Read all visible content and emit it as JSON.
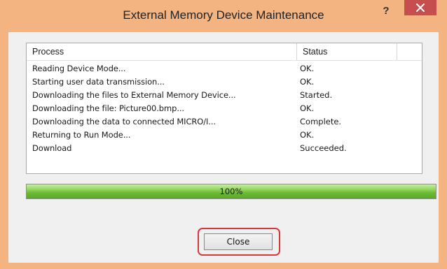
{
  "window": {
    "title": "External Memory Device Maintenance",
    "help_label": "?",
    "title_color": "#f4b482",
    "close_button_color": "#c74e4e"
  },
  "list": {
    "columns": {
      "process": "Process",
      "status": "Status"
    },
    "rows": [
      {
        "process": "Reading Device Mode...",
        "status": "OK."
      },
      {
        "process": "Starting user data transmission...",
        "status": "OK."
      },
      {
        "process": "Downloading the files to External Memory Device...",
        "status": "Started."
      },
      {
        "process": "Downloading the file: Picture00.bmp...",
        "status": "OK."
      },
      {
        "process": "Downloading the data to connected MICRO/I...",
        "status": "Complete."
      },
      {
        "process": "Returning to Run Mode...",
        "status": "OK."
      },
      {
        "process": "Download",
        "status": "Succeeded."
      }
    ]
  },
  "progress": {
    "value": 1.0,
    "label": "100%",
    "color": "#6cba34"
  },
  "footer": {
    "close_label": "Close",
    "highlight_color": "#d9383a"
  }
}
